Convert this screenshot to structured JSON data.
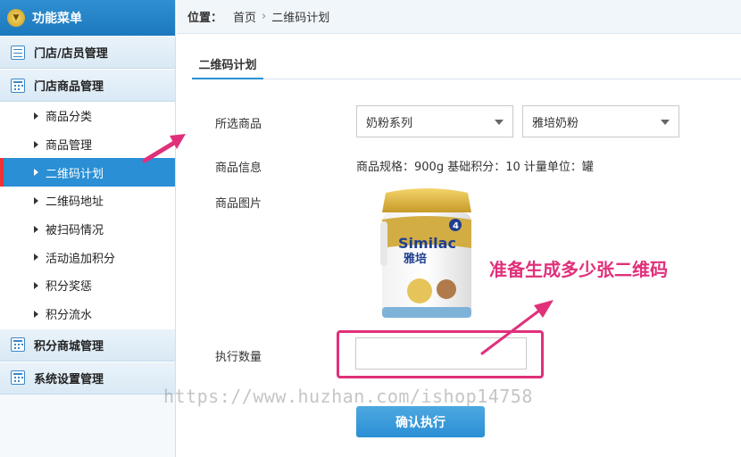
{
  "sidebar": {
    "header": "功能菜单",
    "groups_top": [
      {
        "label": "门店/店员管理"
      },
      {
        "label": "门店商品管理"
      }
    ],
    "items": [
      {
        "label": "商品分类"
      },
      {
        "label": "商品管理"
      },
      {
        "label": "二维码计划",
        "active": true
      },
      {
        "label": "二维码地址"
      },
      {
        "label": "被扫码情况"
      },
      {
        "label": "活动追加积分"
      },
      {
        "label": "积分奖惩"
      },
      {
        "label": "积分流水"
      }
    ],
    "groups_bottom": [
      {
        "label": "积分商城管理"
      },
      {
        "label": "系统设置管理"
      }
    ]
  },
  "breadcrumb": {
    "label": "位置：",
    "home": "首页",
    "current": "二维码计划"
  },
  "tab": {
    "label": "二维码计划"
  },
  "form": {
    "product_label": "所选商品",
    "select1": "奶粉系列",
    "select2": "雅培奶粉",
    "info_label": "商品信息",
    "info_value": "商品规格：900g 基础积分：10 计量单位：罐",
    "image_label": "商品图片",
    "qty_label": "执行数量",
    "qty_value": "",
    "confirm": "确认执行"
  },
  "product_image": {
    "brand": "Similac",
    "brand_cn": "雅培",
    "stage": "4"
  },
  "annotation": "准备生成多少张二维码",
  "watermark": "https://www.huzhan.com/ishop14758",
  "colors": {
    "accent": "#2a8fd4",
    "highlight": "#e0307a"
  }
}
